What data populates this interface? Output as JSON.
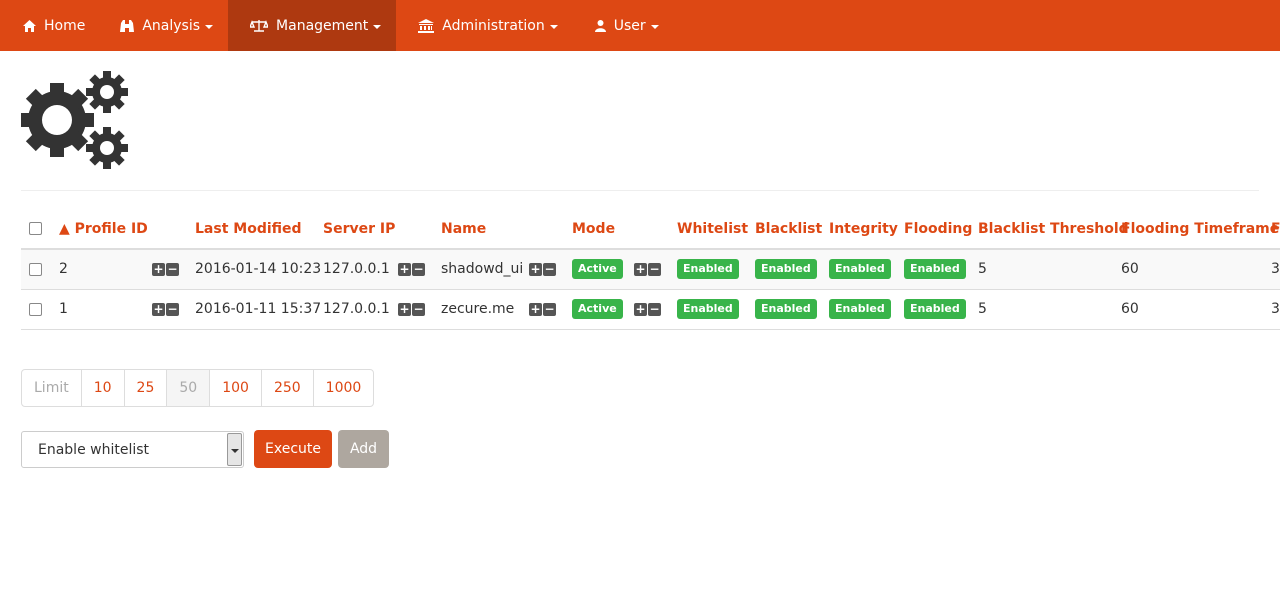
{
  "nav": {
    "home": "Home",
    "analysis": "Analysis",
    "management": "Management",
    "administration": "Administration",
    "user": "User"
  },
  "table": {
    "headers": [
      "▲ Profile ID",
      "Last Modified",
      "Server IP",
      "Name",
      "Mode",
      "Whitelist",
      "Blacklist",
      "Integrity",
      "Flooding",
      "Blacklist Threshold",
      "Flooding Timeframe",
      "F"
    ],
    "rows": [
      {
        "id": "2",
        "last_modified": "2016-01-14 10:23",
        "server_ip": "127.0.0.1",
        "name": "shadowd_ui",
        "mode": "Active",
        "whitelist": "Enabled",
        "blacklist": "Enabled",
        "integrity": "Enabled",
        "flooding": "Enabled",
        "blacklist_threshold": "5",
        "flooding_timeframe": "60",
        "extra": "3"
      },
      {
        "id": "1",
        "last_modified": "2016-01-11 15:37",
        "server_ip": "127.0.0.1",
        "name": "zecure.me",
        "mode": "Active",
        "whitelist": "Enabled",
        "blacklist": "Enabled",
        "integrity": "Enabled",
        "flooding": "Enabled",
        "blacklist_threshold": "5",
        "flooding_timeframe": "60",
        "extra": "3"
      }
    ]
  },
  "pagination": {
    "label": "Limit",
    "options": [
      "10",
      "25",
      "50",
      "100",
      "250",
      "1000"
    ],
    "current": "50"
  },
  "actions": {
    "select_value": "Enable whitelist",
    "execute": "Execute",
    "add": "Add"
  },
  "colors": {
    "brand": "#dd4814",
    "brand_active": "#ae3910",
    "success": "#38b44a",
    "muted": "#aea79f"
  }
}
